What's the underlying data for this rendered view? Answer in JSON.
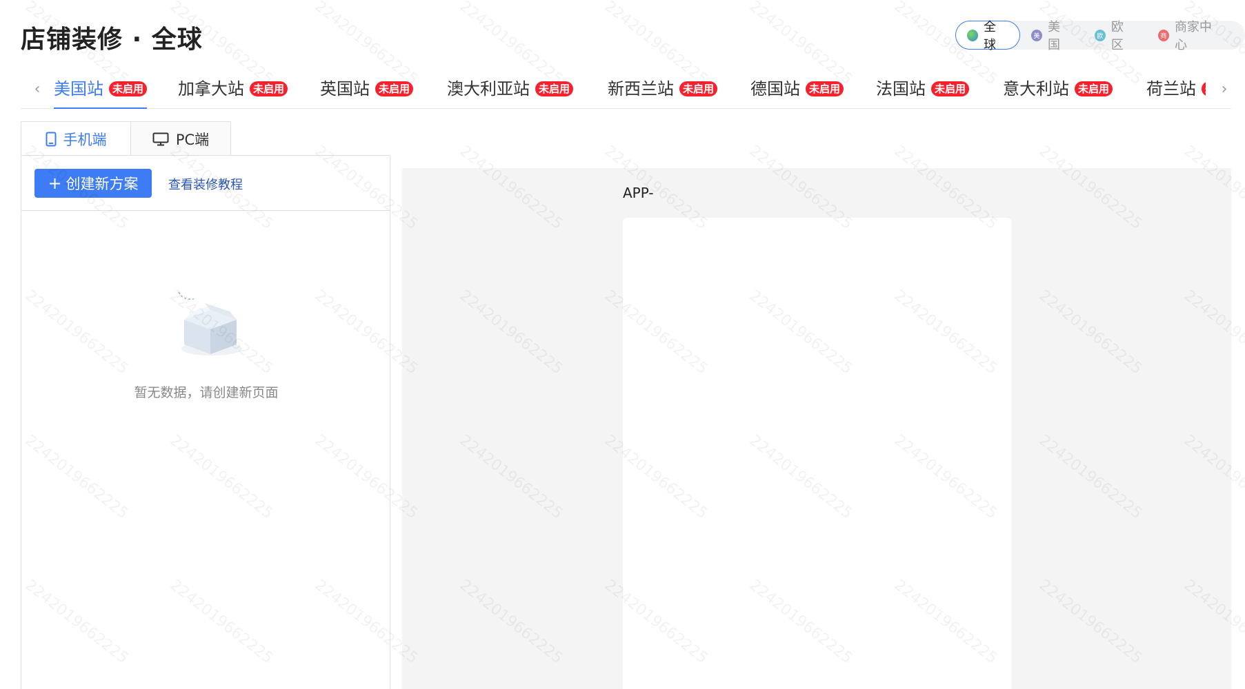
{
  "header": {
    "title": "店铺装修 · 全球",
    "regions": [
      {
        "label": "全球",
        "active": true,
        "color": "#3ba55c"
      },
      {
        "label": "美国",
        "active": false,
        "color": "#8e8cc8",
        "glyph": "美"
      },
      {
        "label": "欧区",
        "active": false,
        "color": "#69c0d6",
        "glyph": "欧"
      },
      {
        "label": "商家中心",
        "active": false,
        "color": "#ef6b6b",
        "glyph": "商"
      }
    ]
  },
  "site_tabs": {
    "badge_text": "未启用",
    "items": [
      {
        "label": "美国站",
        "active": true
      },
      {
        "label": "加拿大站",
        "active": false
      },
      {
        "label": "英国站",
        "active": false
      },
      {
        "label": "澳大利亚站",
        "active": false
      },
      {
        "label": "新西兰站",
        "active": false
      },
      {
        "label": "德国站",
        "active": false
      },
      {
        "label": "法国站",
        "active": false
      },
      {
        "label": "意大利站",
        "active": false
      },
      {
        "label": "荷兰站",
        "active": false
      }
    ]
  },
  "device_tabs": [
    {
      "label": "手机端",
      "icon": "mobile-icon",
      "active": true
    },
    {
      "label": "PC端",
      "icon": "desktop-icon",
      "active": false
    }
  ],
  "left_panel": {
    "create_button": "创建新方案",
    "tutorial_link": "查看装修教程",
    "empty_text": "暂无数据，请创建新页面"
  },
  "preview": {
    "app_label": "APP-"
  },
  "watermark": "2242019662225",
  "colors": {
    "primary": "#3d7cf5",
    "badge": "#f5222d"
  }
}
